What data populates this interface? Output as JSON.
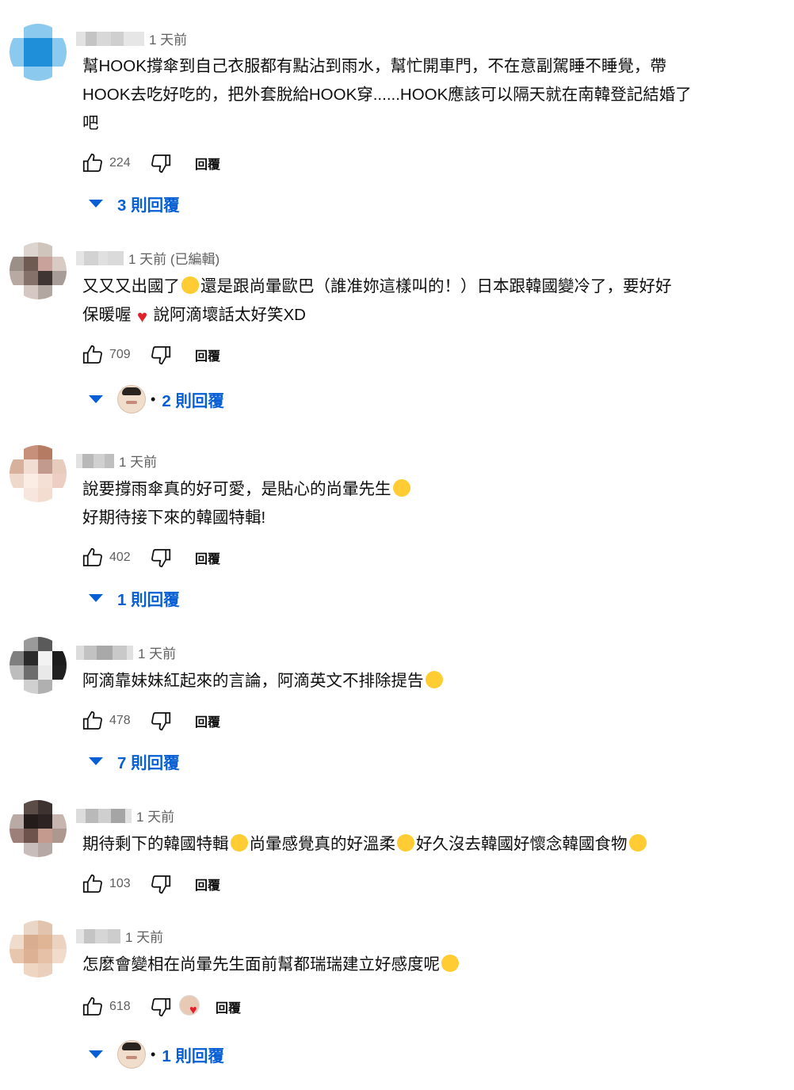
{
  "comments": [
    {
      "time": "1 天前",
      "lines": [
        "幫HOOK撐傘到自己衣服都有點沾到雨水，幫忙開車門，不在意副駕睡不睡覺，帶",
        "HOOK去吃好吃的，把外套脫給HOOK穿......HOOK應該可以隔天就在南韓登記結婚了",
        "吧"
      ],
      "likes": "224",
      "reply_label": "回覆",
      "replies_label": "3 則回覆"
    },
    {
      "time": "1 天前 (已編輯)",
      "line1_a": "又又又出國了",
      "line1_b": "還是跟尚暈歐巴（誰准妳這樣叫的！）日本跟韓國變冷了，要好好",
      "line2_a": "保暖喔",
      "line2_b": "說阿滴壞話太好笑XD",
      "likes": "709",
      "reply_label": "回覆",
      "replies_label": "2 則回覆"
    },
    {
      "time": "1 天前",
      "line1": "說要撐雨傘真的好可愛，是貼心的尚暈先生",
      "line2": "好期待接下來的韓國特輯!",
      "likes": "402",
      "reply_label": "回覆",
      "replies_label": "1 則回覆"
    },
    {
      "time": "1 天前",
      "line1": "阿滴靠妹妹紅起來的言論，阿滴英文不排除提告",
      "likes": "478",
      "reply_label": "回覆",
      "replies_label": "7 則回覆"
    },
    {
      "time": "1 天前",
      "part_a": "期待剩下的韓國特輯",
      "part_b": "尚暈感覺真的好溫柔",
      "part_c": "好久沒去韓國好懷念韓國食物",
      "likes": "103",
      "reply_label": "回覆"
    },
    {
      "time": "1 天前",
      "line1": "怎麼會變相在尚暈先生面前幫都瑞瑞建立好感度呢",
      "likes": "618",
      "reply_label": "回覆",
      "replies_label": "1 則回覆"
    }
  ],
  "icons": {
    "like": "thumbs-up-icon",
    "dislike": "thumbs-down-icon",
    "expand": "caret-down-icon",
    "heart_eyes": "heart-eyes-emoji",
    "red_heart": "red-heart-emoji",
    "rofl": "rofl-emoji",
    "star_struck": "star-struck-emoji",
    "pleading": "pleading-face-emoji",
    "sad": "sad-tear-emoji",
    "creator_heart": "creator-heart-icon"
  },
  "colors": {
    "link_blue": "#065fd4",
    "text": "#0f0f0f",
    "secondary": "#606060",
    "heart_red": "#e0202a"
  },
  "separator": "•"
}
